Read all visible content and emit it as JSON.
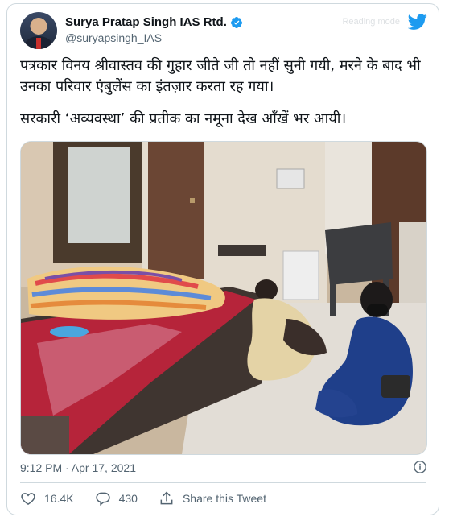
{
  "author": {
    "display_name": "Surya Pratap Singh IAS Rtd.",
    "handle": "@suryapsingh_IAS"
  },
  "header": {
    "faded_label": "Reading mode"
  },
  "tweet": {
    "line1": "पत्रकार विनय श्रीवास्तव की गुहार जीते जी तो नहीं सुनी गयी, मरने के बाद भी उनका परिवार एंबुलेंस का इंतज़ार करता रह गया।",
    "line2": "सरकारी ‘अव्यवस्था’ की प्रतीक का नमूना देख आँखें भर आयी।"
  },
  "meta": {
    "timestamp": "9:12 PM · Apr 17, 2021"
  },
  "actions": {
    "likes": "16.4K",
    "replies": "430",
    "share_label": "Share this Tweet"
  },
  "colors": {
    "accent": "#1d9bf0",
    "text_secondary": "#536471",
    "border": "#cfd9de"
  },
  "icons": [
    "verified-badge-icon",
    "twitter-bird-icon",
    "info-icon",
    "heart-icon",
    "reply-icon",
    "share-icon"
  ]
}
